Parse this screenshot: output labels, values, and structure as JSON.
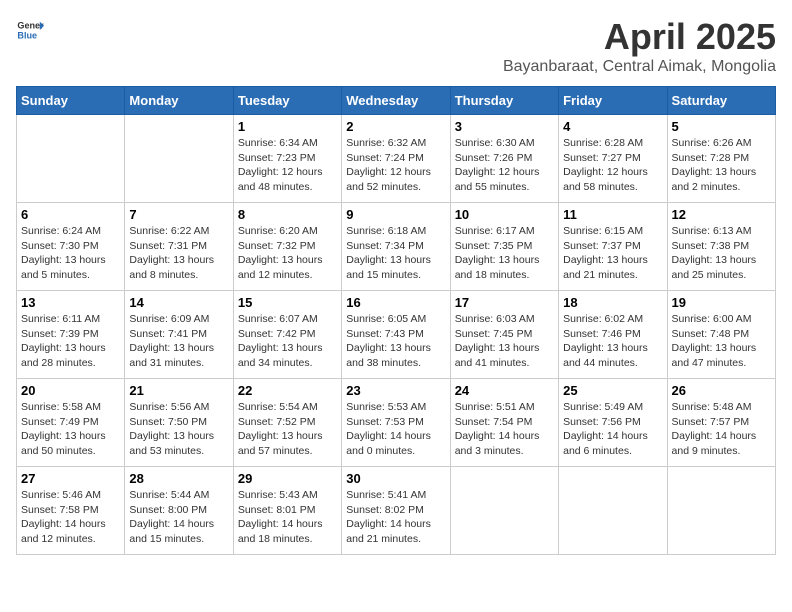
{
  "header": {
    "logo_general": "General",
    "logo_blue": "Blue",
    "month": "April 2025",
    "location": "Bayanbaraat, Central Aimak, Mongolia"
  },
  "weekdays": [
    "Sunday",
    "Monday",
    "Tuesday",
    "Wednesday",
    "Thursday",
    "Friday",
    "Saturday"
  ],
  "weeks": [
    [
      null,
      null,
      {
        "day": 1,
        "sunrise": "6:34 AM",
        "sunset": "7:23 PM",
        "daylight": "12 hours and 48 minutes."
      },
      {
        "day": 2,
        "sunrise": "6:32 AM",
        "sunset": "7:24 PM",
        "daylight": "12 hours and 52 minutes."
      },
      {
        "day": 3,
        "sunrise": "6:30 AM",
        "sunset": "7:26 PM",
        "daylight": "12 hours and 55 minutes."
      },
      {
        "day": 4,
        "sunrise": "6:28 AM",
        "sunset": "7:27 PM",
        "daylight": "12 hours and 58 minutes."
      },
      {
        "day": 5,
        "sunrise": "6:26 AM",
        "sunset": "7:28 PM",
        "daylight": "13 hours and 2 minutes."
      }
    ],
    [
      {
        "day": 6,
        "sunrise": "6:24 AM",
        "sunset": "7:30 PM",
        "daylight": "13 hours and 5 minutes."
      },
      {
        "day": 7,
        "sunrise": "6:22 AM",
        "sunset": "7:31 PM",
        "daylight": "13 hours and 8 minutes."
      },
      {
        "day": 8,
        "sunrise": "6:20 AM",
        "sunset": "7:32 PM",
        "daylight": "13 hours and 12 minutes."
      },
      {
        "day": 9,
        "sunrise": "6:18 AM",
        "sunset": "7:34 PM",
        "daylight": "13 hours and 15 minutes."
      },
      {
        "day": 10,
        "sunrise": "6:17 AM",
        "sunset": "7:35 PM",
        "daylight": "13 hours and 18 minutes."
      },
      {
        "day": 11,
        "sunrise": "6:15 AM",
        "sunset": "7:37 PM",
        "daylight": "13 hours and 21 minutes."
      },
      {
        "day": 12,
        "sunrise": "6:13 AM",
        "sunset": "7:38 PM",
        "daylight": "13 hours and 25 minutes."
      }
    ],
    [
      {
        "day": 13,
        "sunrise": "6:11 AM",
        "sunset": "7:39 PM",
        "daylight": "13 hours and 28 minutes."
      },
      {
        "day": 14,
        "sunrise": "6:09 AM",
        "sunset": "7:41 PM",
        "daylight": "13 hours and 31 minutes."
      },
      {
        "day": 15,
        "sunrise": "6:07 AM",
        "sunset": "7:42 PM",
        "daylight": "13 hours and 34 minutes."
      },
      {
        "day": 16,
        "sunrise": "6:05 AM",
        "sunset": "7:43 PM",
        "daylight": "13 hours and 38 minutes."
      },
      {
        "day": 17,
        "sunrise": "6:03 AM",
        "sunset": "7:45 PM",
        "daylight": "13 hours and 41 minutes."
      },
      {
        "day": 18,
        "sunrise": "6:02 AM",
        "sunset": "7:46 PM",
        "daylight": "13 hours and 44 minutes."
      },
      {
        "day": 19,
        "sunrise": "6:00 AM",
        "sunset": "7:48 PM",
        "daylight": "13 hours and 47 minutes."
      }
    ],
    [
      {
        "day": 20,
        "sunrise": "5:58 AM",
        "sunset": "7:49 PM",
        "daylight": "13 hours and 50 minutes."
      },
      {
        "day": 21,
        "sunrise": "5:56 AM",
        "sunset": "7:50 PM",
        "daylight": "13 hours and 53 minutes."
      },
      {
        "day": 22,
        "sunrise": "5:54 AM",
        "sunset": "7:52 PM",
        "daylight": "13 hours and 57 minutes."
      },
      {
        "day": 23,
        "sunrise": "5:53 AM",
        "sunset": "7:53 PM",
        "daylight": "14 hours and 0 minutes."
      },
      {
        "day": 24,
        "sunrise": "5:51 AM",
        "sunset": "7:54 PM",
        "daylight": "14 hours and 3 minutes."
      },
      {
        "day": 25,
        "sunrise": "5:49 AM",
        "sunset": "7:56 PM",
        "daylight": "14 hours and 6 minutes."
      },
      {
        "day": 26,
        "sunrise": "5:48 AM",
        "sunset": "7:57 PM",
        "daylight": "14 hours and 9 minutes."
      }
    ],
    [
      {
        "day": 27,
        "sunrise": "5:46 AM",
        "sunset": "7:58 PM",
        "daylight": "14 hours and 12 minutes."
      },
      {
        "day": 28,
        "sunrise": "5:44 AM",
        "sunset": "8:00 PM",
        "daylight": "14 hours and 15 minutes."
      },
      {
        "day": 29,
        "sunrise": "5:43 AM",
        "sunset": "8:01 PM",
        "daylight": "14 hours and 18 minutes."
      },
      {
        "day": 30,
        "sunrise": "5:41 AM",
        "sunset": "8:02 PM",
        "daylight": "14 hours and 21 minutes."
      },
      null,
      null,
      null
    ]
  ]
}
